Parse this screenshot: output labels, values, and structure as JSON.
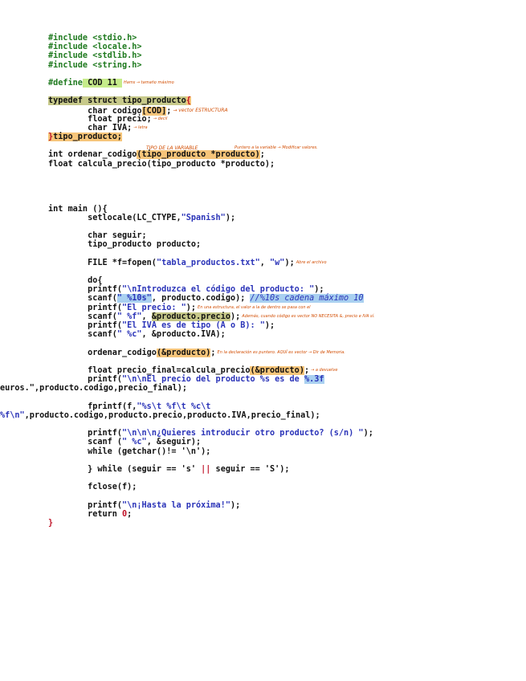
{
  "lines": {
    "inc1": "#include <stdio.h>",
    "inc2": "#include <locale.h>",
    "inc3": "#include <stdlib.h>",
    "inc4": "#include <string.h>",
    "define_kw": "#define",
    "define_val": " COD 11 ",
    "define_note": "Hams → tamaño máximo",
    "typedef_a": "typedef struct tipo_producto",
    "typedef_brace": "{",
    "f_codigo_a": "        char codigo",
    "f_codigo_b": "[COD]",
    "f_codigo_c": ";",
    "f_codigo_note": "→ vector ESTRUCTURA",
    "f_precio": "        float precio;",
    "f_precio_note": "→ decil",
    "f_iva": "        char IVA;",
    "f_iva_note": "→ letra",
    "typedef_close_a": "}",
    "typedef_close_b": "tipo_producto;",
    "annot_tipo": "TIPO DE LA VARIABLE",
    "annot_puntero": "Puntero a la variable → Modificar valores.",
    "proto1_a": "int ordenar_codigo",
    "proto1_b": "(tipo_producto *producto)",
    "proto1_c": ";",
    "proto2": "float calcula_precio(tipo_producto *producto);",
    "main_a": "int main (){",
    "setlocale_a": "        setlocale(LC_CTYPE,",
    "setlocale_str": "\"Spanish\"",
    "setlocale_c": ");",
    "char_seguir": "        char seguir;",
    "tipo_prod_var": "        tipo_producto producto;",
    "file_a": "        FILE *f=fopen(",
    "file_str1": "\"tabla_productos.txt\"",
    "file_b": ", ",
    "file_str2": "\"w\"",
    "file_c": ");",
    "file_note": "Abre el archivo",
    "do": "        do{",
    "printf1_a": "        printf(",
    "printf1_str": "\"\\nIntroduzca el código del producto: \"",
    "printf1_c": ");",
    "scanf1_a": "        scanf(",
    "scanf1_str": "\" %10s\"",
    "scanf1_b": ", producto.codigo); ",
    "scanf1_cmt": "//%10s cadena máximo 10",
    "printf2_a": "        printf(",
    "printf2_str": "\"El precio: \"",
    "printf2_c": ");",
    "printf2_note": "En una estructura, el valor a la de dentro se pasa con el",
    "scanf2_a": "        scanf(",
    "scanf2_str": "\" %f\"",
    "scanf2_b": ", ",
    "scanf2_hl": "&producto.precio",
    "scanf2_c": ");",
    "scanf2_note": "Además, cuando código es vector NO NECESITA &, precio e IVA sí.",
    "printf3_a": "        printf(",
    "printf3_str": "\"El IVA es de tipo (A o B): \"",
    "printf3_c": ");",
    "scanf3_a": "        scanf(",
    "scanf3_str": "\" %c\"",
    "scanf3_b": ", &producto.IVA);",
    "ordenar_a": "        ordenar_codigo",
    "ordenar_hl": "(&producto)",
    "ordenar_c": ";",
    "ordenar_note": "En la declaración es puntero. AQUÍ es vector → Dir de Memoria.",
    "fp_a": "        float precio_final=calcula_precio",
    "fp_hl": "(&producto)",
    "fp_c": ";",
    "fp_note": "→ a devuelve",
    "printf4_a": "        printf(",
    "printf4_str": "\"\\n\\nEl precio del producto %s es de ",
    "printf4_hl": "%.3f",
    "printf4_cont": "euros.\",producto.codigo,precio_final);",
    "fprintf_a": "        fprintf(f,",
    "fprintf_str": "\"%s\\t %f\\t %c\\t",
    "fprintf_cont_str": "%f\\n\"",
    "fprintf_cont_b": ",producto.codigo,producto.precio,producto.IVA,precio_final);",
    "printf5_a": "        printf(",
    "printf5_str": "\"\\n\\n\\n¿Quieres introducir otro producto? (s/n) \"",
    "printf5_c": ");",
    "scanf4_a": "        scanf (",
    "scanf4_str": "\" %c\"",
    "scanf4_b": ", &seguir);",
    "while1": "        while (getchar()!= '\\n');",
    "while2_a": "        } while (seguir == 's' ",
    "while2_or": "||",
    "while2_b": " seguir == 'S');",
    "fclose": "        fclose(f);",
    "printf6_a": "        printf(",
    "printf6_str": "\"\\n¡Hasta la próxima!\"",
    "printf6_c": ");",
    "return_a": "        return ",
    "return_num": "0",
    "return_c": ";",
    "close_main": "}"
  },
  "colors": {
    "preprocessor": "#1f7a1f",
    "string": "#2a33b8",
    "brace": "#c0152a",
    "highlight_green": "#c6ec8a",
    "highlight_orange": "#f6c57a",
    "highlight_blue": "#a9d0f0",
    "note_orange": "#d24c00"
  }
}
